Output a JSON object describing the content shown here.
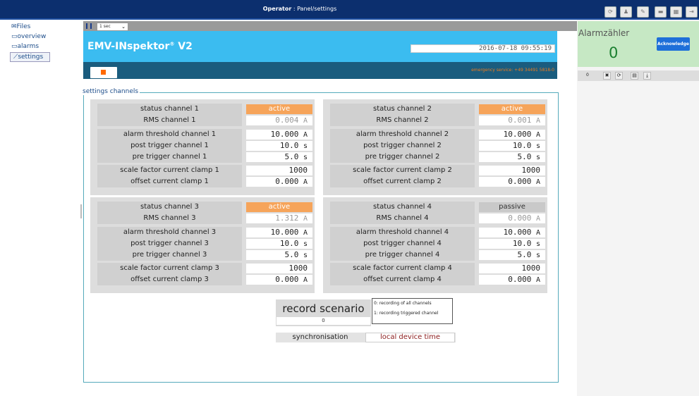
{
  "topbar": {
    "role": "Operator",
    "sep": " : ",
    "path": "Panel/settings"
  },
  "nav": [
    {
      "label": "Files",
      "icon": "file-icon"
    },
    {
      "label": "overview",
      "icon": "folder-icon"
    },
    {
      "label": "alarms",
      "icon": "folder-icon"
    },
    {
      "label": "settings",
      "icon": "chart-icon"
    }
  ],
  "controls": {
    "interval": "1 sec"
  },
  "header": {
    "title": "EMV-INspektor",
    "reg": "®",
    "version": " V2",
    "datetime": "2016-07-18 09:55:19",
    "emergency": "emergency service: +49 34491 5818-0"
  },
  "section_title": "settings channels",
  "channels": [
    {
      "status_label": "status channel 1",
      "status": "active",
      "rms_label": "RMS channel 1",
      "rms": "0.004",
      "threshold_label": "alarm threshold channel 1",
      "threshold": "10.000",
      "post_label": "post trigger channel 1",
      "post": "10.0",
      "pre_label": "pre trigger channel 1",
      "pre": "5.0",
      "scale_label": "scale factor current clamp 1",
      "scale": "1000",
      "offset_label": "offset current clamp 1",
      "offset": "0.000"
    },
    {
      "status_label": "status channel 2",
      "status": "active",
      "rms_label": "RMS channel 2",
      "rms": "0.001",
      "threshold_label": "alarm threshold channel 2",
      "threshold": "10.000",
      "post_label": "post trigger channel 2",
      "post": "10.0",
      "pre_label": "pre trigger channel 2",
      "pre": "5.0",
      "scale_label": "scale factor current clamp 2",
      "scale": "1000",
      "offset_label": "offset current clamp 2",
      "offset": "0.000"
    },
    {
      "status_label": "status channel 3",
      "status": "active",
      "rms_label": "RMS channel 3",
      "rms": "1.312",
      "threshold_label": "alarm threshold channel 3",
      "threshold": "10.000",
      "post_label": "post trigger channel 3",
      "post": "10.0",
      "pre_label": "pre trigger channel 3",
      "pre": "5.0",
      "scale_label": "scale factor current clamp 3",
      "scale": "1000",
      "offset_label": "offset current clamp 3",
      "offset": "0.000"
    },
    {
      "status_label": "status channel 4",
      "status": "passive",
      "rms_label": "RMS channel 4",
      "rms": "0.000",
      "threshold_label": "alarm threshold channel 4",
      "threshold": "10.000",
      "post_label": "post trigger channel 4",
      "post": "10.0",
      "pre_label": "pre trigger channel 4",
      "pre": "5.0",
      "scale_label": "scale factor current clamp 4",
      "scale": "1000",
      "offset_label": "offset current clamp 4",
      "offset": "0.000"
    }
  ],
  "units": {
    "current": "A",
    "time": "s"
  },
  "record": {
    "title": "record scenario",
    "value": "0",
    "opt0": "0: recording of all channels",
    "opt1": "1: recording triggered channel"
  },
  "sync": {
    "label": "synchronisation",
    "value": "local device time"
  },
  "alarm": {
    "title": "Alarmzähler",
    "count": "0",
    "ack": "Acknowledge"
  },
  "right_toolbar": {
    "count": "0"
  },
  "colors": {
    "header": "#0c2f6e",
    "banner": "#3bbcf0",
    "active": "#f6a45a",
    "passive": "#c9c9c9",
    "alarm_bg": "#c6e8c4"
  }
}
